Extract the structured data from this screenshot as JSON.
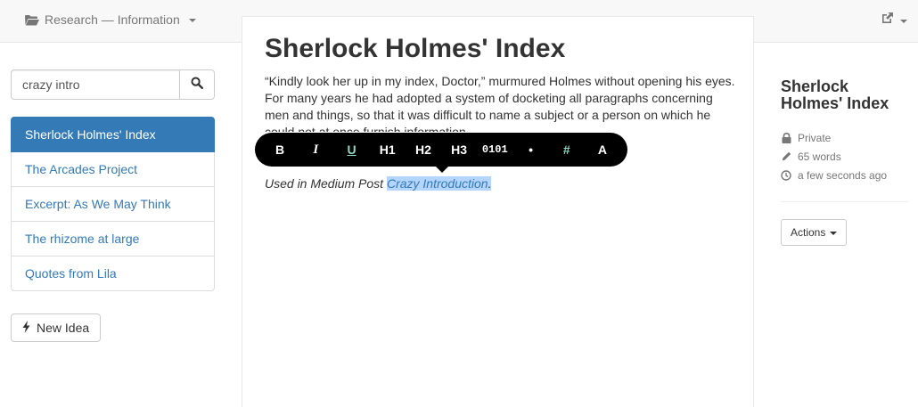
{
  "navbar": {
    "brand_label": "Research — Information",
    "brand_icon": "folder-open-icon",
    "share_icon": "external-link-icon"
  },
  "search": {
    "value": "crazy intro",
    "button_icon": "search-icon"
  },
  "sidebar": {
    "items": [
      {
        "label": "Sherlock Holmes' Index",
        "active": true
      },
      {
        "label": "The Arcades Project",
        "active": false
      },
      {
        "label": "Excerpt: As We May Think",
        "active": false
      },
      {
        "label": "The rhizome at large",
        "active": false
      },
      {
        "label": "Quotes from Lila",
        "active": false
      }
    ],
    "new_idea_label": "New Idea",
    "new_idea_icon": "bolt-icon"
  },
  "editor": {
    "title": "Sherlock Holmes' Index",
    "body": "“Kindly look her up in my index, Doctor,” murmured Holmes without opening his eyes. For many years he had adopted a system of docketing all paragraphs concerning men and things, so that it was difficult to name a subject or a person on which he could not at once furnish information.",
    "note_prefix": "Used in Medium Post ",
    "note_link": "Crazy Introduction",
    "note_suffix": "."
  },
  "toolbar": {
    "bold": "B",
    "italic": "I",
    "underline": "U",
    "h1": "H1",
    "h2": "H2",
    "h3": "H3",
    "code": "0101",
    "bullet": "•",
    "numbered": "#",
    "anchor": "A"
  },
  "meta": {
    "title": "Sherlock Holmes' Index",
    "visibility": "Private",
    "word_count": "65 words",
    "updated": "a few seconds ago",
    "actions_label": "Actions"
  },
  "colors": {
    "accent": "#337ab7",
    "selection": "#b4d5fe",
    "toolbar_highlight": "#8dd7c4"
  }
}
